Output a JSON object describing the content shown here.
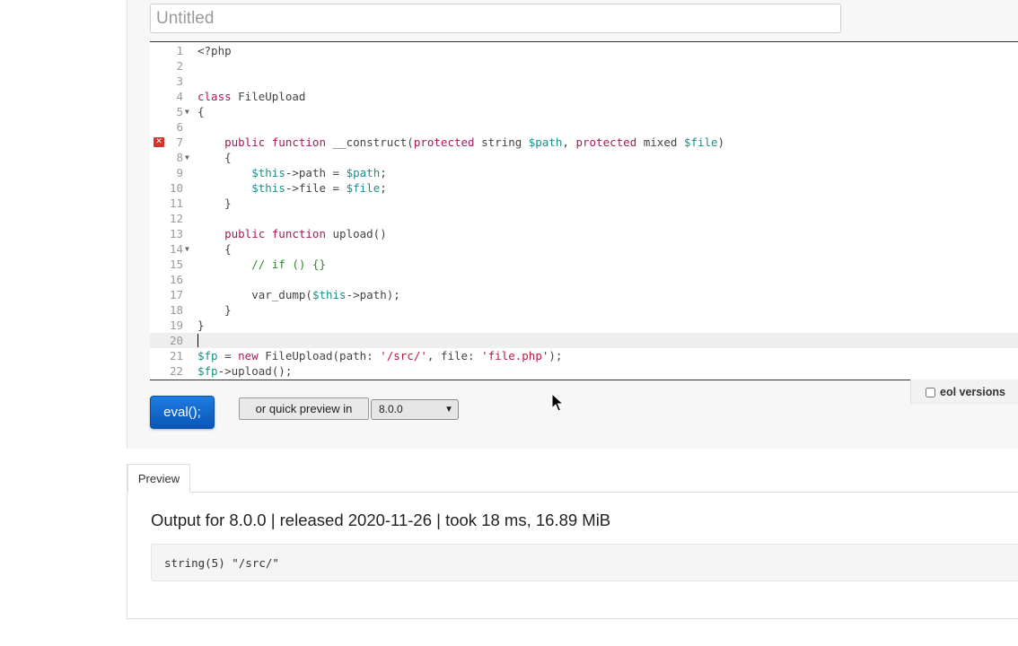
{
  "title_input": {
    "placeholder": "Untitled",
    "value": ""
  },
  "editor": {
    "active_line": 20,
    "error_line": 7,
    "lines": [
      {
        "num": "1",
        "tokens": [
          {
            "t": "<?php",
            "c": "plain"
          }
        ]
      },
      {
        "num": "2",
        "tokens": []
      },
      {
        "num": "3",
        "tokens": []
      },
      {
        "num": "4",
        "tokens": [
          {
            "t": "class ",
            "c": "kw"
          },
          {
            "t": "FileUpload",
            "c": "plain"
          }
        ]
      },
      {
        "num": "5",
        "fold": true,
        "tokens": [
          {
            "t": "{",
            "c": "plain"
          }
        ]
      },
      {
        "num": "6",
        "tokens": []
      },
      {
        "num": "7",
        "error": true,
        "tokens": [
          {
            "t": "    public function ",
            "c": "kw"
          },
          {
            "t": "__construct(",
            "c": "plain"
          },
          {
            "t": "protected",
            "c": "kw"
          },
          {
            "t": " string ",
            "c": "plain"
          },
          {
            "t": "$path",
            "c": "var"
          },
          {
            "t": ", ",
            "c": "plain"
          },
          {
            "t": "protected",
            "c": "kw"
          },
          {
            "t": " mixed ",
            "c": "plain"
          },
          {
            "t": "$file",
            "c": "var"
          },
          {
            "t": ")",
            "c": "plain"
          }
        ]
      },
      {
        "num": "8",
        "fold": true,
        "tokens": [
          {
            "t": "    {",
            "c": "plain"
          }
        ]
      },
      {
        "num": "9",
        "tokens": [
          {
            "t": "        ",
            "c": "plain"
          },
          {
            "t": "$this",
            "c": "var"
          },
          {
            "t": "->path = ",
            "c": "plain"
          },
          {
            "t": "$path",
            "c": "var"
          },
          {
            "t": ";",
            "c": "plain"
          }
        ]
      },
      {
        "num": "10",
        "tokens": [
          {
            "t": "        ",
            "c": "plain"
          },
          {
            "t": "$this",
            "c": "var"
          },
          {
            "t": "->file = ",
            "c": "plain"
          },
          {
            "t": "$file",
            "c": "var"
          },
          {
            "t": ";",
            "c": "plain"
          }
        ]
      },
      {
        "num": "11",
        "tokens": [
          {
            "t": "    }",
            "c": "plain"
          }
        ]
      },
      {
        "num": "12",
        "tokens": []
      },
      {
        "num": "13",
        "tokens": [
          {
            "t": "    public function ",
            "c": "kw"
          },
          {
            "t": "upload()",
            "c": "plain"
          }
        ]
      },
      {
        "num": "14",
        "fold": true,
        "tokens": [
          {
            "t": "    {",
            "c": "plain"
          }
        ]
      },
      {
        "num": "15",
        "tokens": [
          {
            "t": "        // if () {}",
            "c": "cmt"
          }
        ]
      },
      {
        "num": "16",
        "tokens": []
      },
      {
        "num": "17",
        "tokens": [
          {
            "t": "        var_dump(",
            "c": "plain"
          },
          {
            "t": "$this",
            "c": "var"
          },
          {
            "t": "->path);",
            "c": "plain"
          }
        ]
      },
      {
        "num": "18",
        "tokens": [
          {
            "t": "    }",
            "c": "plain"
          }
        ]
      },
      {
        "num": "19",
        "tokens": [
          {
            "t": "}",
            "c": "plain"
          }
        ]
      },
      {
        "num": "20",
        "tokens": []
      },
      {
        "num": "21",
        "tokens": [
          {
            "t": "$fp",
            "c": "var"
          },
          {
            "t": " = ",
            "c": "plain"
          },
          {
            "t": "new",
            "c": "kw"
          },
          {
            "t": " FileUpload(path: ",
            "c": "plain"
          },
          {
            "t": "'/src/'",
            "c": "str"
          },
          {
            "t": ", file: ",
            "c": "plain"
          },
          {
            "t": "'file.php'",
            "c": "str"
          },
          {
            "t": ");",
            "c": "plain"
          }
        ]
      },
      {
        "num": "22",
        "tokens": [
          {
            "t": "$fp",
            "c": "var"
          },
          {
            "t": "->upload();",
            "c": "plain"
          }
        ]
      }
    ]
  },
  "controls": {
    "eval_label": "eval();",
    "quick_preview_label": "or quick preview in",
    "version_selected": "8.0.0",
    "eol_label": "eol versions",
    "eol_checked": false
  },
  "tabs": [
    {
      "label": "Preview",
      "active": true
    }
  ],
  "output": {
    "heading": "Output for 8.0.0 | released 2020-11-26 | took 18 ms, 16.89 MiB",
    "text": "string(5) \"/src/\""
  },
  "icons": {
    "error_marker": "error-x-icon",
    "fold": "fold-arrow-icon",
    "select_arrow": "chevron-down-icon",
    "cursor": "mouse-pointer-icon"
  }
}
